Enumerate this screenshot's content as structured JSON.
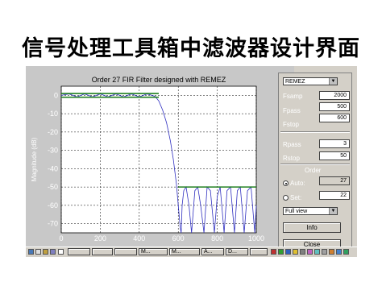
{
  "slide": {
    "title": "信号处理工具箱中滤波器设计界面"
  },
  "chart_data": {
    "type": "line",
    "title": "Order 27 FIR Filter designed with REMEZ",
    "xlabel": "",
    "ylabel": "Magnitude (dB)",
    "xlim": [
      0,
      1000
    ],
    "ylim": [
      -75,
      5
    ],
    "xticks": [
      0,
      200,
      400,
      600,
      800,
      1000
    ],
    "yticks": [
      0,
      -10,
      -20,
      -30,
      -40,
      -50,
      -60,
      -70
    ],
    "grid": true,
    "series": [
      {
        "color": "#3030c0",
        "x": [
          0,
          40,
          80,
          120,
          160,
          200,
          240,
          280,
          320,
          360,
          400,
          440,
          480,
          500,
          520,
          540,
          560,
          575,
          590,
          600,
          610,
          615,
          620,
          628,
          640,
          655,
          668,
          685,
          700,
          715,
          732,
          748,
          765,
          785,
          800,
          815,
          835,
          850,
          868,
          888,
          903,
          918,
          938,
          955,
          973,
          992,
          1000
        ],
        "y": [
          0,
          0.8,
          -0.8,
          0.8,
          -0.8,
          0.8,
          -0.8,
          0.8,
          -0.8,
          0.8,
          -0.8,
          0.8,
          -0.5,
          -3,
          -8,
          -15,
          -25,
          -35,
          -48,
          -60,
          -72,
          -75,
          -60,
          -52,
          -50,
          -60,
          -75,
          -52,
          -50,
          -60,
          -75,
          -50,
          -52,
          -75,
          -55,
          -50,
          -75,
          -52,
          -50,
          -75,
          -52,
          -50,
          -75,
          -52,
          -50,
          -75,
          -60
        ]
      }
    ],
    "specs": [
      {
        "color": "#208020",
        "x": [
          0,
          500
        ],
        "y": [
          1
        ]
      },
      {
        "color": "#208020",
        "x": [
          0,
          500
        ],
        "y": [
          -1
        ]
      },
      {
        "color": "#208020",
        "x": [
          600,
          1000
        ],
        "y": [
          -50
        ]
      }
    ]
  },
  "panel": {
    "method": "REMEZ",
    "fsamp_label": "Fsamp",
    "fsamp_value": "2000",
    "fpass_label": "Fpass",
    "fpass_value": "500",
    "fstop_label": "Fstop",
    "fstop_value": "600",
    "rpass_label": "Rpass",
    "rpass_value": "3",
    "rstop_label": "Rstop",
    "rstop_value": "50",
    "order_label": "Order",
    "auto_label": "Auto:",
    "auto_value": "27",
    "set_label": "Set:",
    "set_value": "22",
    "view": "Full view",
    "info_label": "Info",
    "close_label": "Close"
  },
  "taskbar": {
    "tasks": [
      "M...",
      "M...",
      "A...",
      "D..."
    ]
  }
}
